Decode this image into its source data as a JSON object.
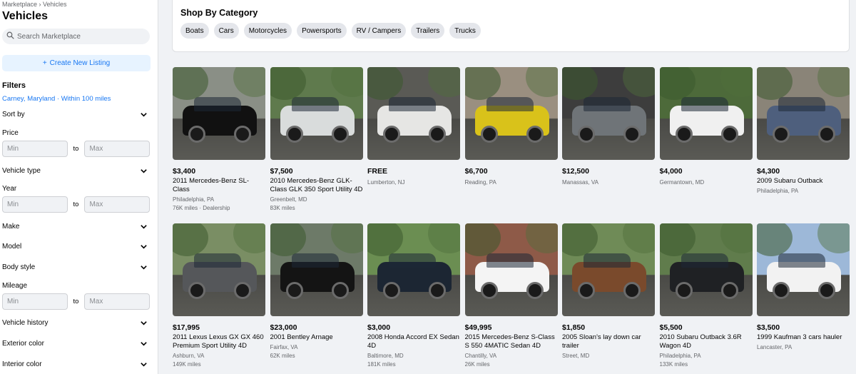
{
  "breadcrumb": "Marketplace › Vehicles",
  "page_title": "Vehicles",
  "search": {
    "placeholder": "Search Marketplace"
  },
  "create_listing": {
    "plus": "+",
    "label": "Create New Listing"
  },
  "filters": {
    "title": "Filters",
    "location": "Carney, Maryland · Within 100 miles",
    "sort_by": "Sort by",
    "price": {
      "label": "Price",
      "min": "Min",
      "to": "to",
      "max": "Max"
    },
    "vehicle_type": "Vehicle type",
    "year": {
      "label": "Year",
      "min": "Min",
      "to": "to",
      "max": "Max"
    },
    "make": "Make",
    "model": "Model",
    "body_style": "Body style",
    "mileage": {
      "label": "Mileage",
      "min": "Min",
      "to": "to",
      "max": "Max"
    },
    "vehicle_history": "Vehicle history",
    "exterior_color": "Exterior color",
    "interior_color": "Interior color"
  },
  "categories": {
    "title": "Shop By Category",
    "items": [
      "Boats",
      "Cars",
      "Motorcycles",
      "Powersports",
      "RV / Campers",
      "Trailers",
      "Trucks"
    ]
  },
  "listings": [
    {
      "price": "$3,400",
      "title": "2011 Mercedes-Benz SL-Class",
      "location": "Philadelphia, PA",
      "miles": "76K miles · Dealership",
      "colors": {
        "bg": "#8a8f86",
        "car": "#111111"
      }
    },
    {
      "price": "$7,500",
      "title": "2010 Mercedes-Benz GLK-Class GLK 350 Sport Utility 4D",
      "location": "Greenbelt, MD",
      "miles": "83K miles",
      "colors": {
        "bg": "#5f7a4d",
        "car": "#d9dcdc"
      }
    },
    {
      "price": "FREE",
      "title": "",
      "location": "Lumberton, NJ",
      "miles": "",
      "colors": {
        "bg": "#5a5a55",
        "car": "#e6e6e4"
      }
    },
    {
      "price": "$6,700",
      "title": "",
      "location": "Reading, PA",
      "miles": "",
      "colors": {
        "bg": "#9a8f80",
        "car": "#d9c21a"
      }
    },
    {
      "price": "$12,500",
      "title": "",
      "location": "Manassas, VA",
      "miles": "",
      "colors": {
        "bg": "#3d3d3d",
        "car": "#6f7478"
      }
    },
    {
      "price": "$4,000",
      "title": "",
      "location": "Germantown, MD",
      "miles": "",
      "colors": {
        "bg": "#4d6a3a",
        "car": "#f0f0f0"
      }
    },
    {
      "price": "$4,300",
      "title": "2009 Subaru Outback",
      "location": "Philadelphia, PA",
      "miles": "",
      "colors": {
        "bg": "#8a8478",
        "car": "#4e5f7d"
      }
    },
    {
      "price": "$17,995",
      "title": "2011 Lexus Lexus GX GX 460 Premium Sport Utility 4D",
      "location": "Ashburn, VA",
      "miles": "149K miles",
      "colors": {
        "bg": "#7a8e64",
        "car": "#55575a"
      }
    },
    {
      "price": "$23,000",
      "title": "2001 Bentley Arnage",
      "location": "Fairfax, VA",
      "miles": "62K miles",
      "colors": {
        "bg": "#6d7a68",
        "car": "#141414"
      }
    },
    {
      "price": "$3,000",
      "title": "2008 Honda Accord EX Sedan 4D",
      "location": "Baltimore, MD",
      "miles": "181K miles",
      "colors": {
        "bg": "#6b8e52",
        "car": "#1c2633"
      }
    },
    {
      "price": "$49,995",
      "title": "2015 Mercedes-Benz S-Class S 550 4MATIC Sedan 4D",
      "location": "Chantilly, VA",
      "miles": "26K miles",
      "colors": {
        "bg": "#8e5a48",
        "car": "#f4f4f4"
      }
    },
    {
      "price": "$1,850",
      "title": "2005 Sloan's lay down car trailer",
      "location": "Street, MD",
      "miles": "",
      "colors": {
        "bg": "#6f8b57",
        "car": "#7a4a2c"
      }
    },
    {
      "price": "$5,500",
      "title": "2010 Subaru Outback 3.6R Wagon 4D",
      "location": "Philadelphia, PA",
      "miles": "133K miles",
      "colors": {
        "bg": "#607c4c",
        "car": "#1f2124"
      }
    },
    {
      "price": "$3,500",
      "title": "1999 Kaufman 3 cars hauler",
      "location": "Lancaster, PA",
      "miles": "",
      "colors": {
        "bg": "#9db8d8",
        "car": "#f2f2f2"
      }
    }
  ]
}
